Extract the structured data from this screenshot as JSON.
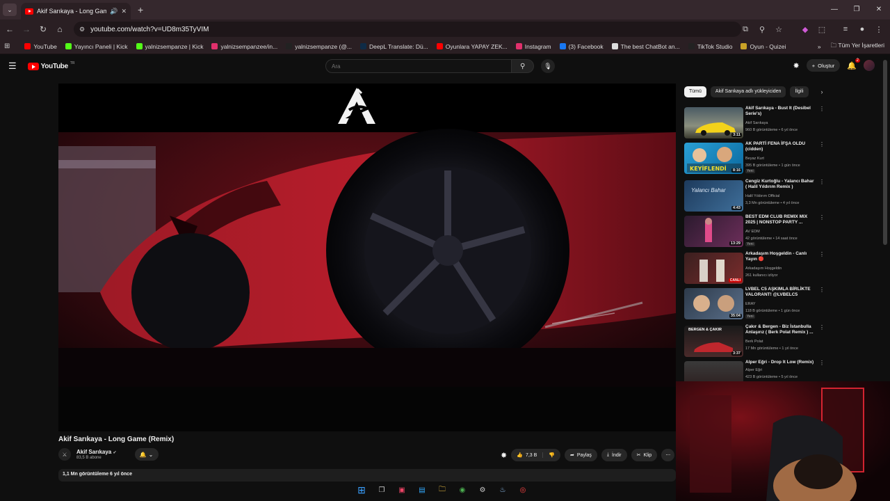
{
  "browser": {
    "tab_title": "Akif Sarıkaya - Long Game",
    "url": "youtube.com/watch?v=UD8m35TyVIM",
    "new_tab_symbol": "+",
    "bookmarks": [
      {
        "label": "YouTube",
        "color": "#ff0000"
      },
      {
        "label": "Yayıncı Paneli | Kick",
        "color": "#53fc18"
      },
      {
        "label": "yalnizsempanze | Kick",
        "color": "#53fc18"
      },
      {
        "label": "yalnizsempanzee/in...",
        "color": "#e1306c"
      },
      {
        "label": "yalnizsempanze (@...",
        "color": "#222222"
      },
      {
        "label": "DeepL Translate: Dü...",
        "color": "#0f2b46"
      },
      {
        "label": "Oyunlara YAPAY ZEK...",
        "color": "#ff0000"
      },
      {
        "label": "Instagram",
        "color": "#e1306c"
      },
      {
        "label": "(3) Facebook",
        "color": "#1877f2"
      },
      {
        "label": "The best ChatBot an...",
        "color": "#dddddd"
      },
      {
        "label": "TikTok Studio",
        "color": "#222222"
      },
      {
        "label": "Oyun - Quizei",
        "color": "#c9a227"
      }
    ],
    "all_bookmarks_label": "Tüm Yer İşaretleri"
  },
  "youtube": {
    "logo_text": "YouTube",
    "region": "TR",
    "search_placeholder": "Ara",
    "create_label": "Oluştur",
    "notification_count": "2",
    "video": {
      "title": "Akif Sarıkaya - Long Game (Remix)",
      "channel_name": "Akif Sarıkaya",
      "subscribers": "83,5 B abone",
      "likes": "7,3 B",
      "share_label": "Paylaş",
      "download_label": "İndir",
      "clip_label": "Klip",
      "views_date": "1,1 Mn görüntüleme  6 yıl önce"
    },
    "chips": [
      "Tümü",
      "Akif Sarıkaya adlı yükleyiciden",
      "İlgili"
    ],
    "recommendations": [
      {
        "title": "Akif Sarıkaya - Bust It (Desibel Serie's)",
        "channel": "Akif Sarıkaya",
        "meta": "960 B görüntüleme • 6 yıl önce",
        "duration": "3:11",
        "badge": ""
      },
      {
        "title": "AK PARTİ FENA İFŞA OLDU (cidden)",
        "channel": "Beyaz Kurt",
        "meta": "395 B görüntüleme • 1 gün önce",
        "duration": "8:16",
        "badge": "Yeni"
      },
      {
        "title": "Cengiz Kurtoğlu - Yalancı Bahar ( Halil Yıldırım Remix )",
        "channel": "Halil Yıldırım Official",
        "meta": "3,3 Mn görüntüleme • 4 yıl önce",
        "duration": "4:43",
        "badge": ""
      },
      {
        "title": "BEST EDM CLUB REMIX MIX 2025 | NONSTOP PARTY ...",
        "channel": "AV EDM",
        "meta": "42 görüntüleme • 14 saat önce",
        "duration": "13:29",
        "badge": "Yeni"
      },
      {
        "title": "Arkadaşım Hoşgeldin - Canlı Yayın 🔴",
        "channel": "Arkadaşım Hoşgeldin",
        "meta": "261 kullanıcı izliyor",
        "duration": "",
        "badge": "",
        "live": "CANLI"
      },
      {
        "title": "LVBEL C5 AŞKIMLA BİRLİKTE VALORANT! @LVBELC5",
        "channel": "ERAY",
        "meta": "118 B görüntüleme • 1 gün önce",
        "duration": "35:04",
        "badge": "Yeni"
      },
      {
        "title": "Çakır & Bergen - Biz İstanbulla Anlaşırız ( Berk Polat Remix ) ...",
        "channel": "Berk Polat",
        "meta": "17 Mn görüntüleme • 1 yıl önce",
        "duration": "3:37",
        "badge": ""
      },
      {
        "title": "Alper Eğri - Drop It Low (Remix)",
        "channel": "Alper Eğri",
        "meta": "423 B görüntüleme • 5 yıl önce",
        "duration": "",
        "badge": ""
      }
    ],
    "thumb_texts": {
      "keyiflendi": "KEYİFLENDİ",
      "yalanci_bahar": "Yalancı Bahar",
      "bergen_cakir": "BERGEN & ÇAKIR"
    }
  },
  "icons": {
    "like": "thumbs-up-icon",
    "dislike": "thumbs-down-icon",
    "share": "share-icon",
    "download": "download-icon",
    "clip": "scissors-icon"
  }
}
